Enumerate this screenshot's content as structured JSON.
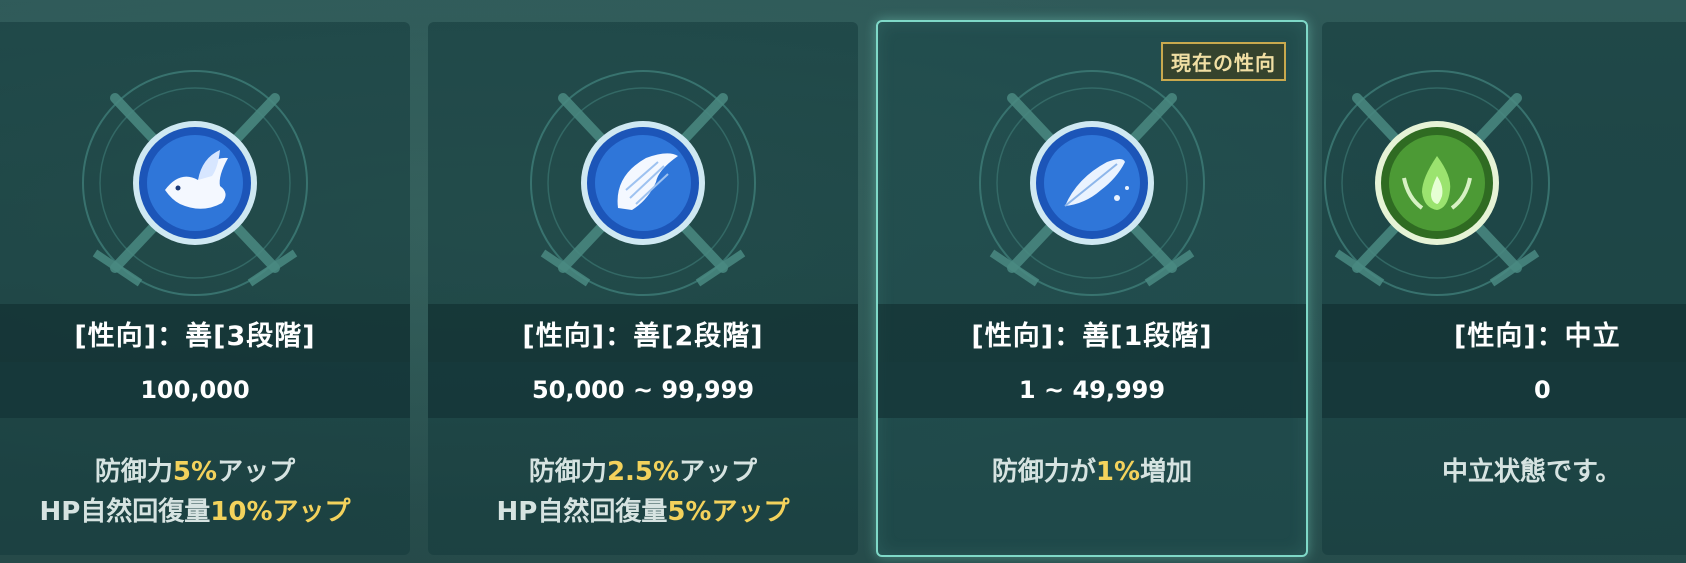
{
  "badge_current": "現在の性向",
  "cards": [
    {
      "title": "[性向]：善[3段階]",
      "range": "100,000",
      "effect_line1_pre": "防御力",
      "effect_line1_val": "5%",
      "effect_line1_post": "アップ",
      "effect_line2_pre": "HP自然回復量",
      "effect_line2_val": "10%",
      "effect_line2_post": "アップ",
      "icon": "dove-icon"
    },
    {
      "title": "[性向]：善[2段階]",
      "range": "50,000 ~ 99,999",
      "effect_line1_pre": "防御力",
      "effect_line1_val": "2.5%",
      "effect_line1_post": "アップ",
      "effect_line2_pre": "HP自然回復量",
      "effect_line2_val": "5%",
      "effect_line2_post": "アップ",
      "icon": "wing-icon"
    },
    {
      "title": "[性向]：善[1段階]",
      "range": "1 ~ 49,999",
      "effect_line1_pre": "防御力が",
      "effect_line1_val": "1%",
      "effect_line1_post": "増加",
      "icon": "feather-icon"
    },
    {
      "title": "[性向]：中立",
      "range": "0",
      "effect_line1_pre": "中立状態です。",
      "icon": "green-flame-icon"
    }
  ],
  "colors": {
    "accent_highlight": "#f3d25c",
    "selected_border": "#7fd9c8",
    "good_emblem": "#2a6fd6",
    "neutral_emblem": "#4fa53c"
  }
}
